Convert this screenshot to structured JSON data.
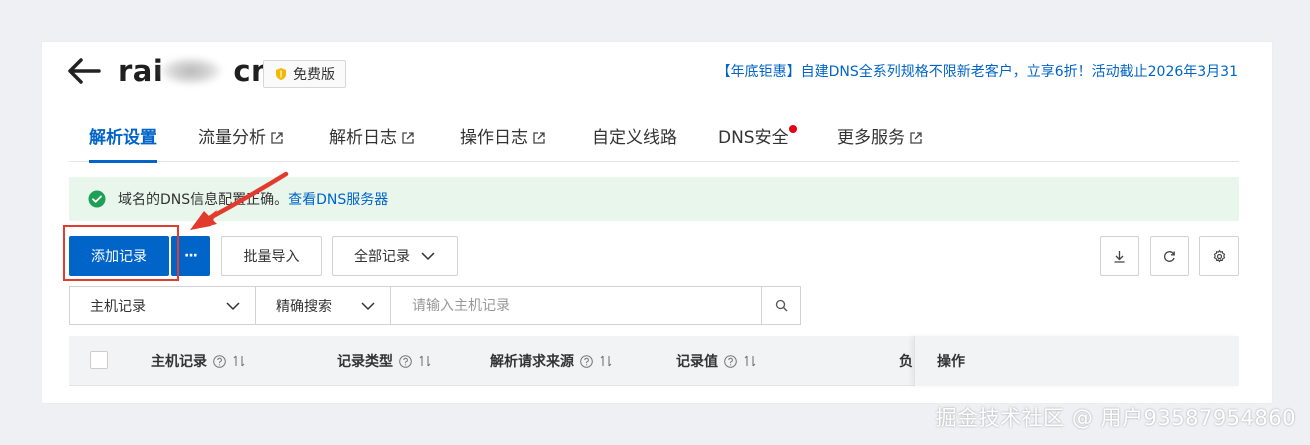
{
  "header": {
    "domain": "rai     .cn",
    "domain_left": "rai",
    "domain_right": "cn",
    "plan_badge": "免费版",
    "promo": "【年底钜惠】自建DNS全系列规格不限新老客户，立享6折！活动截止2026年3月31"
  },
  "tabs": [
    {
      "label": "解析设置",
      "active": true,
      "external": false
    },
    {
      "label": "流量分析",
      "active": false,
      "external": true
    },
    {
      "label": "解析日志",
      "active": false,
      "external": true
    },
    {
      "label": "操作日志",
      "active": false,
      "external": true
    },
    {
      "label": "自定义线路",
      "active": false,
      "external": false
    },
    {
      "label": "DNS安全",
      "active": false,
      "external": false,
      "dot": true
    },
    {
      "label": "更多服务",
      "active": false,
      "external": true
    }
  ],
  "alert": {
    "text": "域名的DNS信息配置正确。",
    "link": "查看DNS服务器"
  },
  "toolbar": {
    "add_record": "添加记录",
    "more": "···",
    "batch_import": "批量导入",
    "filter_all": "全部记录"
  },
  "search": {
    "field_select": "主机记录",
    "mode_select": "精确搜索",
    "placeholder": "请输入主机记录"
  },
  "table": {
    "columns": [
      "主机记录",
      "记录类型",
      "解析请求来源",
      "记录值",
      "负"
    ],
    "action_column": "操作"
  },
  "watermark": "掘金技术社区 @ 用户93587954860",
  "colors": {
    "primary": "#0064c8",
    "alert_bg": "#e8f6ec",
    "success": "#1e9f56",
    "annotation": "#e23b2e"
  }
}
